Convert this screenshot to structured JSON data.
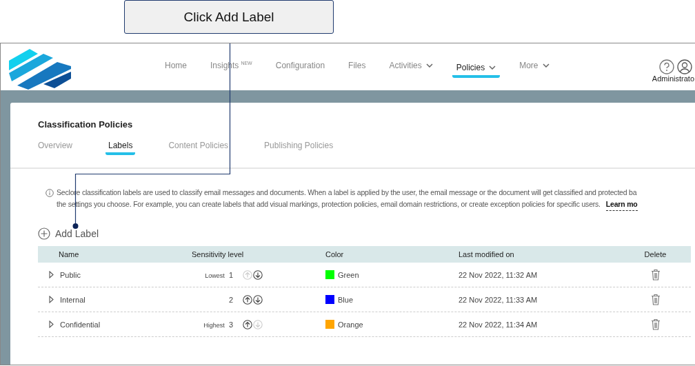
{
  "callout": {
    "text": "Click Add Label"
  },
  "nav": {
    "items": [
      {
        "label": "Home",
        "selected": false
      },
      {
        "label": "Insights",
        "badge": "NEW",
        "selected": false
      },
      {
        "label": "Configuration",
        "selected": false
      },
      {
        "label": "Files",
        "selected": false
      },
      {
        "label": "Activities",
        "dropdown": true,
        "selected": false
      },
      {
        "label": "Policies",
        "dropdown": true,
        "selected": true
      },
      {
        "label": "More",
        "dropdown": true,
        "selected": false
      }
    ],
    "user": "Administrato"
  },
  "page": {
    "title": "Classification Policies",
    "tabs": [
      {
        "label": "Overview",
        "selected": false
      },
      {
        "label": "Labels",
        "selected": true
      },
      {
        "label": "Content Policies",
        "selected": false
      },
      {
        "label": "Publishing Policies",
        "selected": false
      }
    ],
    "info_lines": [
      "Seclore classification labels are used to classify email messages and documents. When a label is applied by the user, the email message or the document will get classified and protected ba",
      "the settings you choose. For example, you can create labels that add visual markings, protection policies, email domain restrictions, or create exception policies for specific users."
    ],
    "info_link": "Learn mo",
    "add_button": "Add Label"
  },
  "table": {
    "columns": [
      "Name",
      "Sensitivity level",
      "Color",
      "Last modified on",
      "Delete"
    ],
    "rows": [
      {
        "name": "Public",
        "tag": "Lowest",
        "level": "1",
        "up_disabled": true,
        "down_disabled": false,
        "color": "#00ff00",
        "color_name": "Green",
        "modified": "22 Nov 2022, 11:32 AM"
      },
      {
        "name": "Internal",
        "level": "2",
        "up_disabled": false,
        "down_disabled": false,
        "color": "#0000ff",
        "color_name": "Blue",
        "modified": "22 Nov 2022, 11:33 AM"
      },
      {
        "name": "Confidential",
        "tag": "Highest",
        "level": "3",
        "up_disabled": false,
        "down_disabled": true,
        "color": "#ffa500",
        "color_name": "Orange",
        "modified": "22 Nov 2022, 11:34 AM"
      }
    ]
  }
}
